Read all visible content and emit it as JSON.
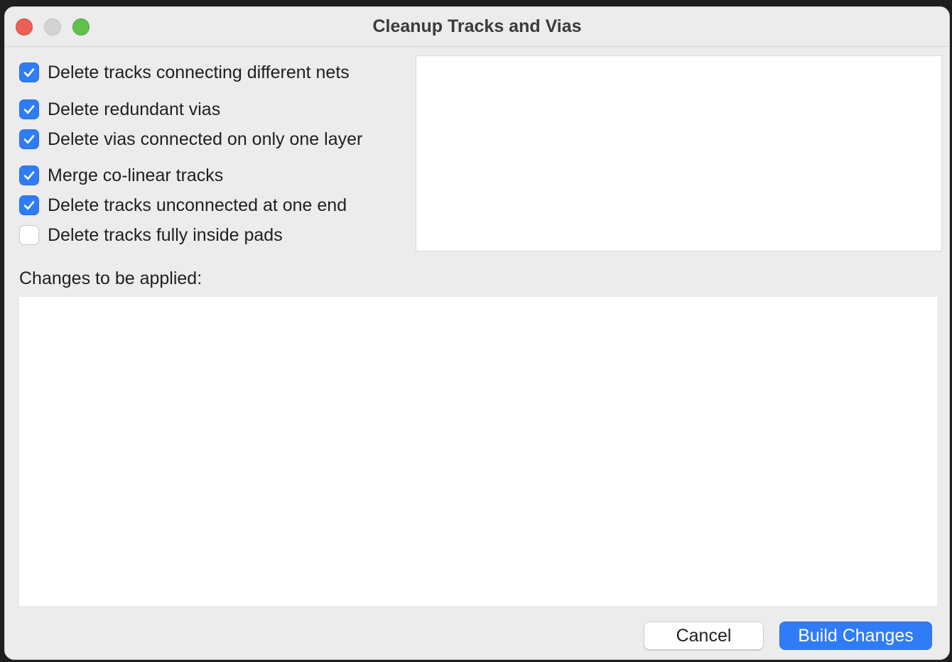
{
  "window": {
    "title": "Cleanup Tracks and Vias"
  },
  "options": [
    {
      "label": "Delete tracks connecting different nets",
      "checked": true
    },
    {
      "label": "Delete redundant vias",
      "checked": true
    },
    {
      "label": "Delete vias connected on only one layer",
      "checked": true
    },
    {
      "label": "Merge co-linear tracks",
      "checked": true
    },
    {
      "label": "Delete tracks unconnected at one end",
      "checked": true
    },
    {
      "label": "Delete tracks fully inside pads",
      "checked": false
    }
  ],
  "changes": {
    "label": "Changes to be applied:"
  },
  "buttons": {
    "cancel": "Cancel",
    "build": "Build Changes"
  },
  "colors": {
    "accent": "#2f7cf6",
    "close": "#ec5f57",
    "minimize": "#d3d3d3",
    "maximize": "#5fc24d"
  }
}
